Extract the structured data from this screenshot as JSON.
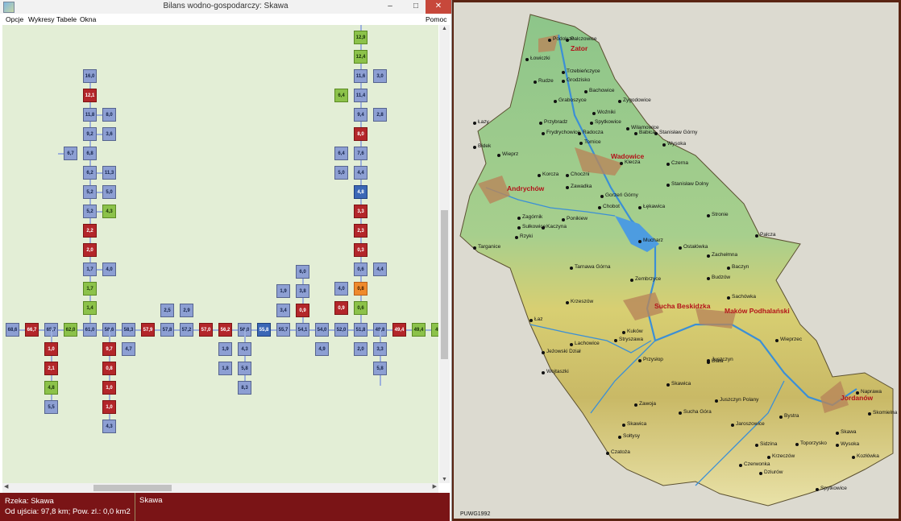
{
  "window": {
    "title": "Bilans wodno-gospodarczy: Skawa",
    "minimize": "–",
    "maximize": "□",
    "close": "✕"
  },
  "menu": {
    "items": [
      "Opcje",
      "Wykresy",
      "Tabele",
      "Okna"
    ],
    "help": "Pomoc"
  },
  "colors": {
    "blue": "#8d9fd3",
    "red": "#b3262a",
    "green": "#8cc24a",
    "dark_blue": "#3b67b6",
    "orange": "#ef8a2c",
    "status_bg": "#7a1416",
    "canvas_bg": "#e3eed6"
  },
  "scheme": {
    "main_row": [
      "68,6",
      "66,7",
      "65,7",
      "62,0",
      "61,0",
      "58,6",
      "58,3",
      "57,9",
      "57,8",
      "57,2",
      "57,0",
      "56,2",
      "56,0",
      "55,8",
      "55,7",
      "54,1",
      "54,0",
      "52,0",
      "51,8",
      "49,8",
      "49,4",
      "49,4",
      "49"
    ],
    "left_branch": [
      "16,0",
      "12,1",
      "11,8",
      "9,2",
      "6,8",
      "6,2",
      "5,2",
      "5,2",
      "2,2",
      "2,0",
      "1,7",
      "1,7",
      "1,4"
    ],
    "left_side": [
      "8,0",
      "3,6",
      "6,7",
      "11,3",
      "5,0",
      "4,3",
      "4,0"
    ],
    "left_down": [
      "1,0",
      "2,1",
      "4,8",
      "5,5"
    ],
    "center_down": [
      "9,7",
      "0,8",
      "1,0",
      "1,0",
      "4,3",
      "4,7"
    ],
    "center_up": [
      "2,5",
      "2,9"
    ],
    "mid_down": [
      "1,9",
      "4,3",
      "1,8",
      "5,8",
      "8,3"
    ],
    "right_up": [
      "6,0",
      "1,9",
      "3,8",
      "3,4",
      "0,9"
    ],
    "right_down": [
      "4,9"
    ],
    "far_right_branch": [
      "12,9",
      "12,4",
      "11,6",
      "3,0",
      "6,4",
      "11,4",
      "9,4",
      "2,8",
      "8,0",
      "6,4",
      "7,6",
      "5,0",
      "4,4",
      "4,8",
      "3,3",
      "2,3",
      "0,3",
      "0,6",
      "4,4",
      "4,0",
      "0,8",
      "0,9",
      "0,6"
    ],
    "far_right_down": [
      "2,0",
      "3,3",
      "5,8"
    ]
  },
  "status": {
    "river_label": "Rzeka:",
    "river_name": "Skawa",
    "distance_line": "Od ujścia: 97,8 km;  Pow. zl.: 0,0 km2",
    "right_text": "Skawa"
  },
  "map": {
    "projection": "PUWG1992",
    "towns": [
      "Wadowice",
      "Andrychów",
      "Sucha Beskidzka",
      "Maków Podhalański",
      "Jordanów",
      "Zator"
    ],
    "villages": [
      "Podolsze",
      "Palczowice",
      "Łowiczki",
      "Trzebieńczyce",
      "Rudze",
      "Grodzisko",
      "Bachowice",
      "Graboszyce",
      "Woźniki",
      "Spytkowice",
      "Zygodowice",
      "Przybradz",
      "Frydrychowice",
      "Radocza",
      "Wilamowice",
      "Babica",
      "Stanisław Górny",
      "Łazy",
      "Tomice",
      "Wysoka",
      "Bidek",
      "Wieprz",
      "Kleczа",
      "Czerna",
      "Korcza",
      "Choczni",
      "Gorzeń Górny",
      "Stanisław Dolny",
      "Zawadka",
      "Chobot",
      "Łękawica",
      "Stronie",
      "Zagórnik",
      "Sułkowice",
      "Kaczyna",
      "Ponikiew",
      "Palcza",
      "Targanice",
      "Rzyki",
      "Mucharz",
      "Ostałówka",
      "Zachełmna",
      "Baczyn",
      "Tarnawa Górna",
      "Zembrzyce",
      "Budzów",
      "Sachówka",
      "Łaz",
      "Krzeszów",
      "Kuków",
      "Stryszawa",
      "Lachowice",
      "Jeżowski Dział",
      "Juszczyn",
      "Wojtaszki",
      "Zawoja",
      "Przysłop",
      "Skawica",
      "Biała",
      "Wieprzec",
      "Naprawa",
      "Bystra",
      "Skomielna",
      "Juszczyn Polany",
      "Jaroszowice",
      "Sidzina",
      "Toporzysko",
      "Krzeczów",
      "Czatoża",
      "Sołtysy",
      "Skawa",
      "Kozłówka",
      "Wysoka",
      "Czerwonka",
      "Dziurów",
      "Spytkowice",
      "Skawica",
      "Sucha Góra"
    ]
  }
}
